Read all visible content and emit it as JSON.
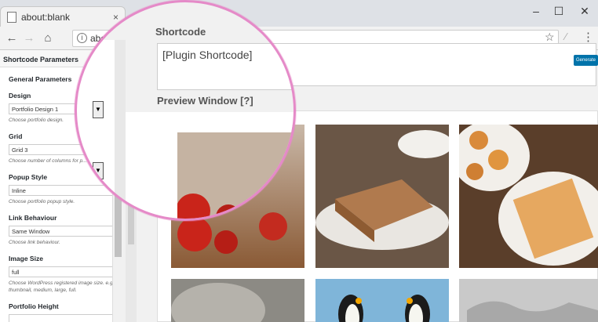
{
  "browser": {
    "tab_title": "about:blank",
    "tab_close": "×",
    "address": "about:blank",
    "window_controls": [
      "–",
      "☐",
      "✕"
    ],
    "nav_icons": [
      "back-icon",
      "forward-icon",
      "home-icon"
    ]
  },
  "sidebar": {
    "title": "Shortcode Parameters",
    "section": "General Parameters",
    "fields": [
      {
        "label": "Design",
        "value": "Portfolio Design 1",
        "help": "Choose portfolio design."
      },
      {
        "label": "Grid",
        "value": "Grid 3",
        "help": "Choose number of columns for p..."
      },
      {
        "label": "Popup Style",
        "value": "Inline",
        "help": "Choose portfolio popup style."
      },
      {
        "label": "Link Behaviour",
        "value": "Same Window",
        "help": "Choose link behaviour."
      },
      {
        "label": "Image Size",
        "value": "full",
        "help": "Choose WordPress registered image size. e.g thumbnail, medium, large, full."
      },
      {
        "label": "Portfolio Height",
        "value": "",
        "help": ""
      }
    ]
  },
  "main": {
    "shortcode_label": "Shortcode",
    "shortcode_value": "[Plugin Shortcode]",
    "generate_label": "Generate",
    "preview_label": "Preview Window [?]"
  },
  "colors": {
    "accent": "#0073aa",
    "lens": "#e58ac8"
  }
}
